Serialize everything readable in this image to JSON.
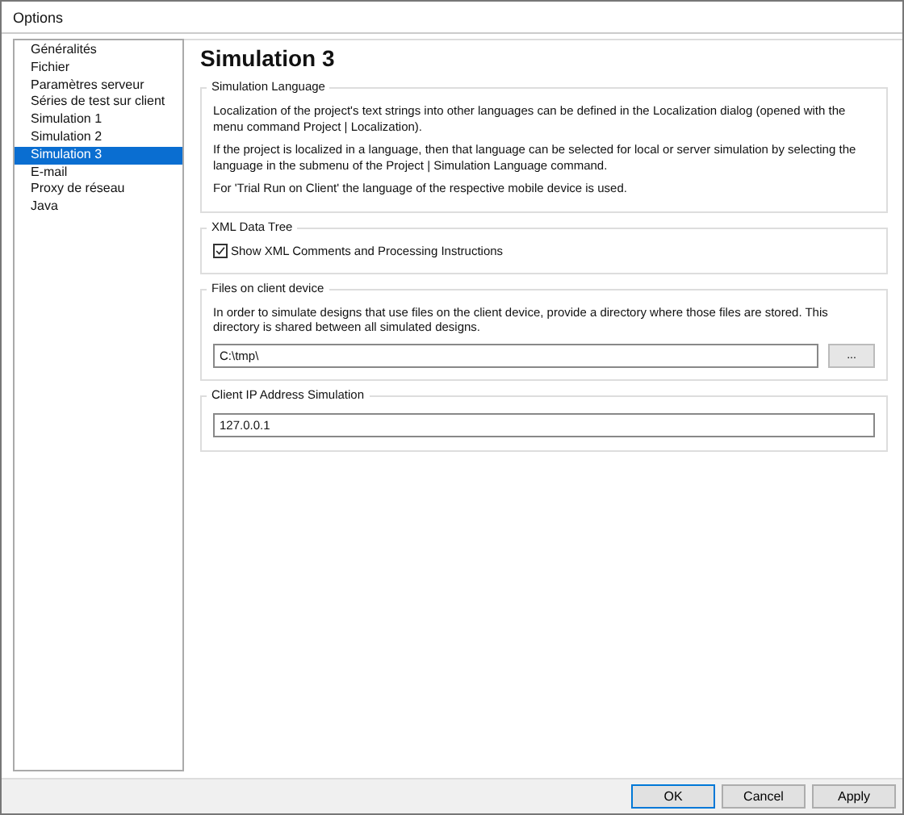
{
  "window": {
    "title": "Options"
  },
  "sidebar": {
    "items": [
      {
        "label": "Généralités",
        "selected": false
      },
      {
        "label": "Fichier",
        "selected": false
      },
      {
        "label": "Paramètres serveur",
        "selected": false
      },
      {
        "label": "Séries de test sur client",
        "selected": false
      },
      {
        "label": "Simulation 1",
        "selected": false
      },
      {
        "label": "Simulation 2",
        "selected": false
      },
      {
        "label": "Simulation 3",
        "selected": true
      },
      {
        "label": "E-mail",
        "selected": false
      },
      {
        "label": "Proxy de réseau",
        "selected": false
      },
      {
        "label": "Java",
        "selected": false
      }
    ]
  },
  "page": {
    "title": "Simulation 3",
    "groups": [
      {
        "kind": "text",
        "title": "Simulation Language",
        "paragraphs": [
          "Localization of the project's text  strings into other languages can be defined in the Localization dialog (opened with the menu command Project | Localization).",
          "If the project is localized in a language, then that language can be selected for local or server simulation by selecting the language in the submenu of the Project | Simulation Language command.",
          "For 'Trial Run on Client' the language of the respective mobile device is used."
        ]
      },
      {
        "kind": "checkbox",
        "title": "XML Data Tree",
        "label": "Show XML Comments and Processing Instructions",
        "checked": true
      },
      {
        "kind": "folder",
        "title": "Files on client device",
        "paragraphs": [
          "In order to simulate designs that use files on the client device, provide a directory where those files are stored. This directory is shared between all simulated designs."
        ],
        "value": "C:\\tmp\\",
        "browse": "..."
      },
      {
        "kind": "field",
        "title": "Client IP Address Simulation",
        "value": "127.0.0.1"
      }
    ]
  },
  "buttons": [
    {
      "label": "OK",
      "default": true
    },
    {
      "label": "Cancel",
      "default": false
    },
    {
      "label": "Apply",
      "default": false
    }
  ]
}
